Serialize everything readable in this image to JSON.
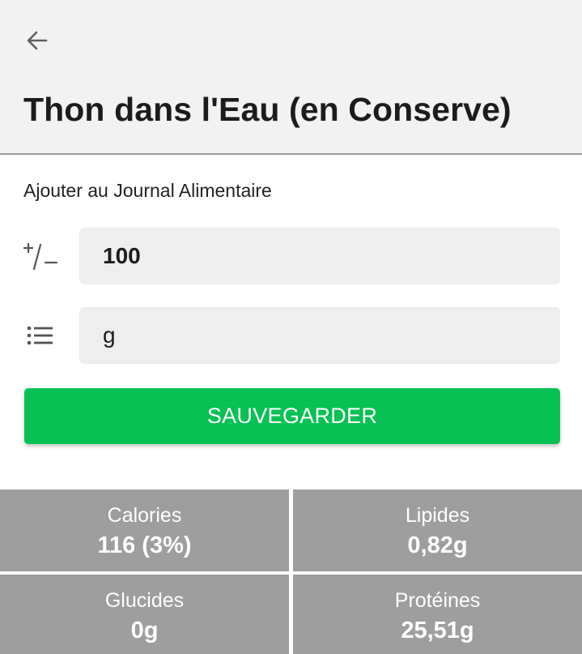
{
  "header": {
    "back_icon": "arrow-left-icon",
    "title": "Thon dans l'Eau (en Conserve)"
  },
  "form": {
    "section_label": "Ajouter au Journal Alimentaire",
    "quantity_icon": "plus-minus-icon",
    "quantity_value": "100",
    "unit_icon": "list-icon",
    "unit_value": "g",
    "save_label": "SAUVEGARDER"
  },
  "nutrients": [
    {
      "name": "Calories",
      "value": "116 (3%)"
    },
    {
      "name": "Lipides",
      "value": "0,82g"
    },
    {
      "name": "Glucides",
      "value": "0g"
    },
    {
      "name": "Protéines",
      "value": "25,51g"
    }
  ],
  "colors": {
    "accent": "#07c152",
    "header_bg": "#f2f2f2",
    "tile_bg": "#9e9e9e"
  }
}
